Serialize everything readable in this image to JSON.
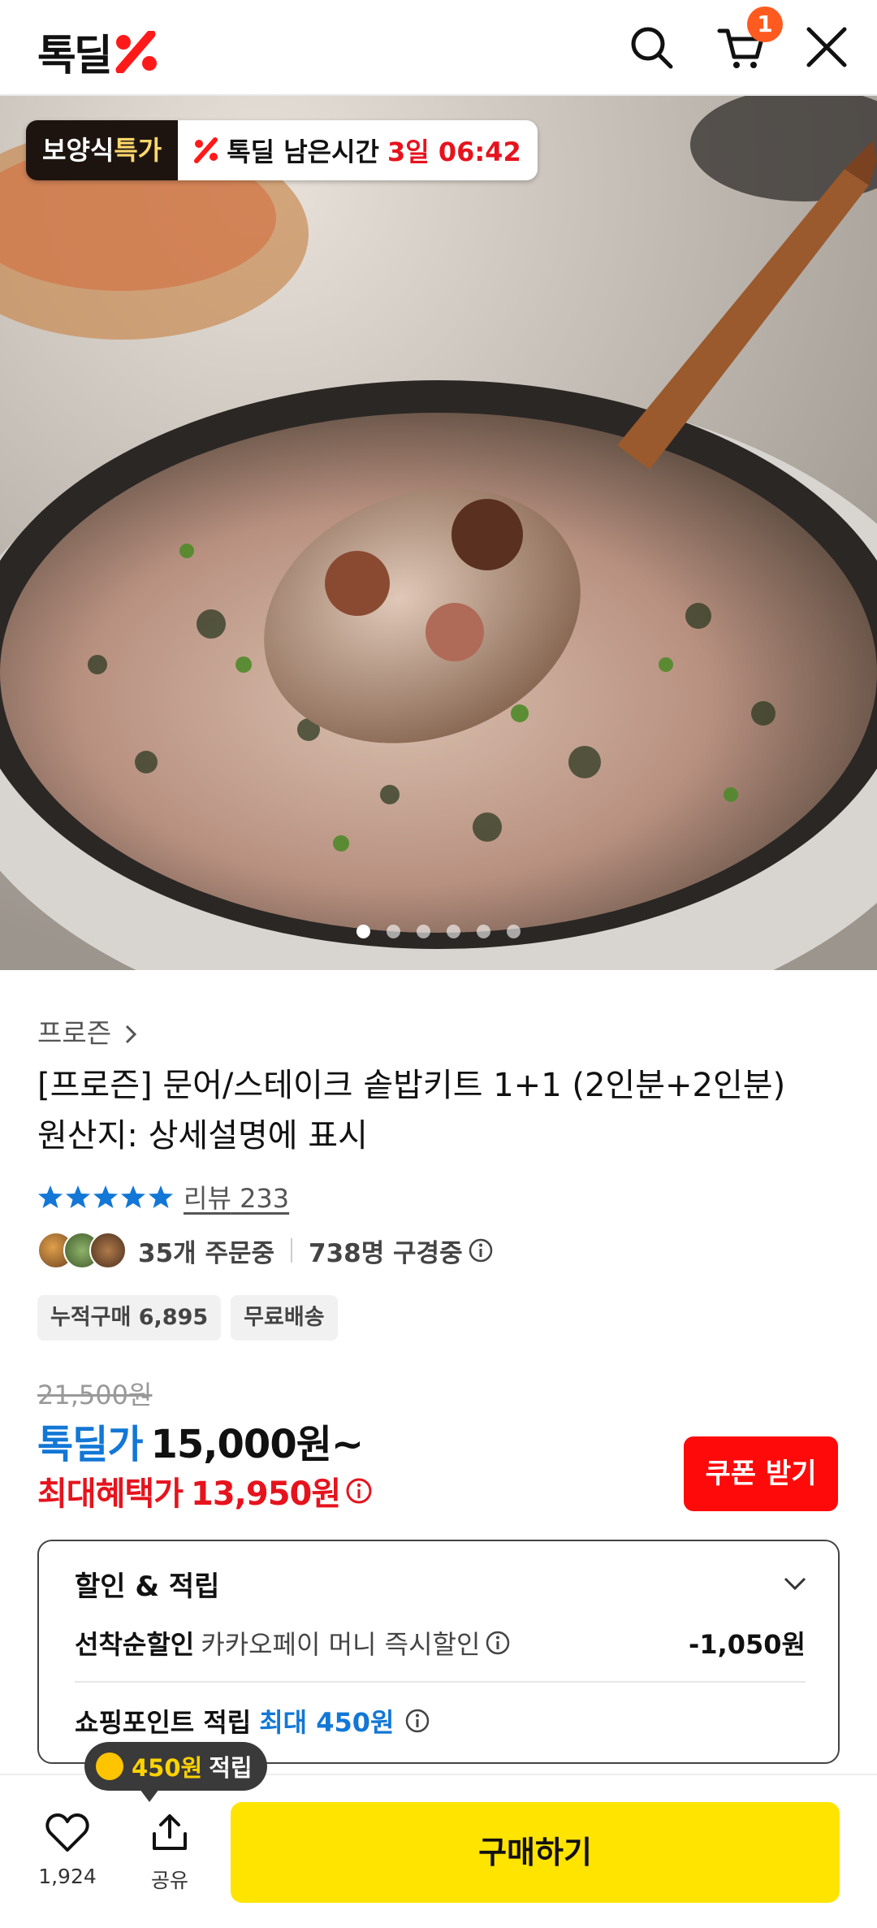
{
  "header": {
    "logo": "톡딜",
    "cart_count": "1"
  },
  "hero": {
    "promo_tag_part1": "보양식",
    "promo_tag_part2": "특가",
    "timer_label": "톡딜 남은시간",
    "timer_value": "3일 06:42",
    "dots_count": 6,
    "active_dot": 0
  },
  "product": {
    "category": "프로즌",
    "title_line1": "[프로즌] 문어/스테이크 솥밥키트 1+1 (2인분+2인분)",
    "title_line2": "원산지: 상세설명에 표시",
    "rating": 4.8,
    "review_label": "리뷰",
    "review_count": "233",
    "ordering": "35개 주문중",
    "viewing": "738명 구경중",
    "chips": [
      "누적구매 6,895",
      "무료배송"
    ]
  },
  "price": {
    "original": "21,500원",
    "deal_label": "톡딜가",
    "deal_price": "15,000원~",
    "max_label": "최대혜택가",
    "max_price": "13,950원",
    "coupon_button": "쿠폰 받기"
  },
  "benefits": {
    "title": "할인 & 적립",
    "row1_key": "선착순할인",
    "row1_desc": "카카오페이 머니 즉시할인",
    "row1_amount": "-1,050원",
    "row2_key": "쇼핑포인트 적립",
    "row2_value": "최대 450원"
  },
  "bottom": {
    "tooltip_amount": "450원",
    "tooltip_suffix": "적립",
    "like_count": "1,924",
    "share_label": "공유",
    "buy_button": "구매하기"
  },
  "colors": {
    "accent_yellow": "#ffe400",
    "deal_blue": "#1277d6",
    "price_red": "#e6131d",
    "coupon_red": "#ff0a0a"
  }
}
